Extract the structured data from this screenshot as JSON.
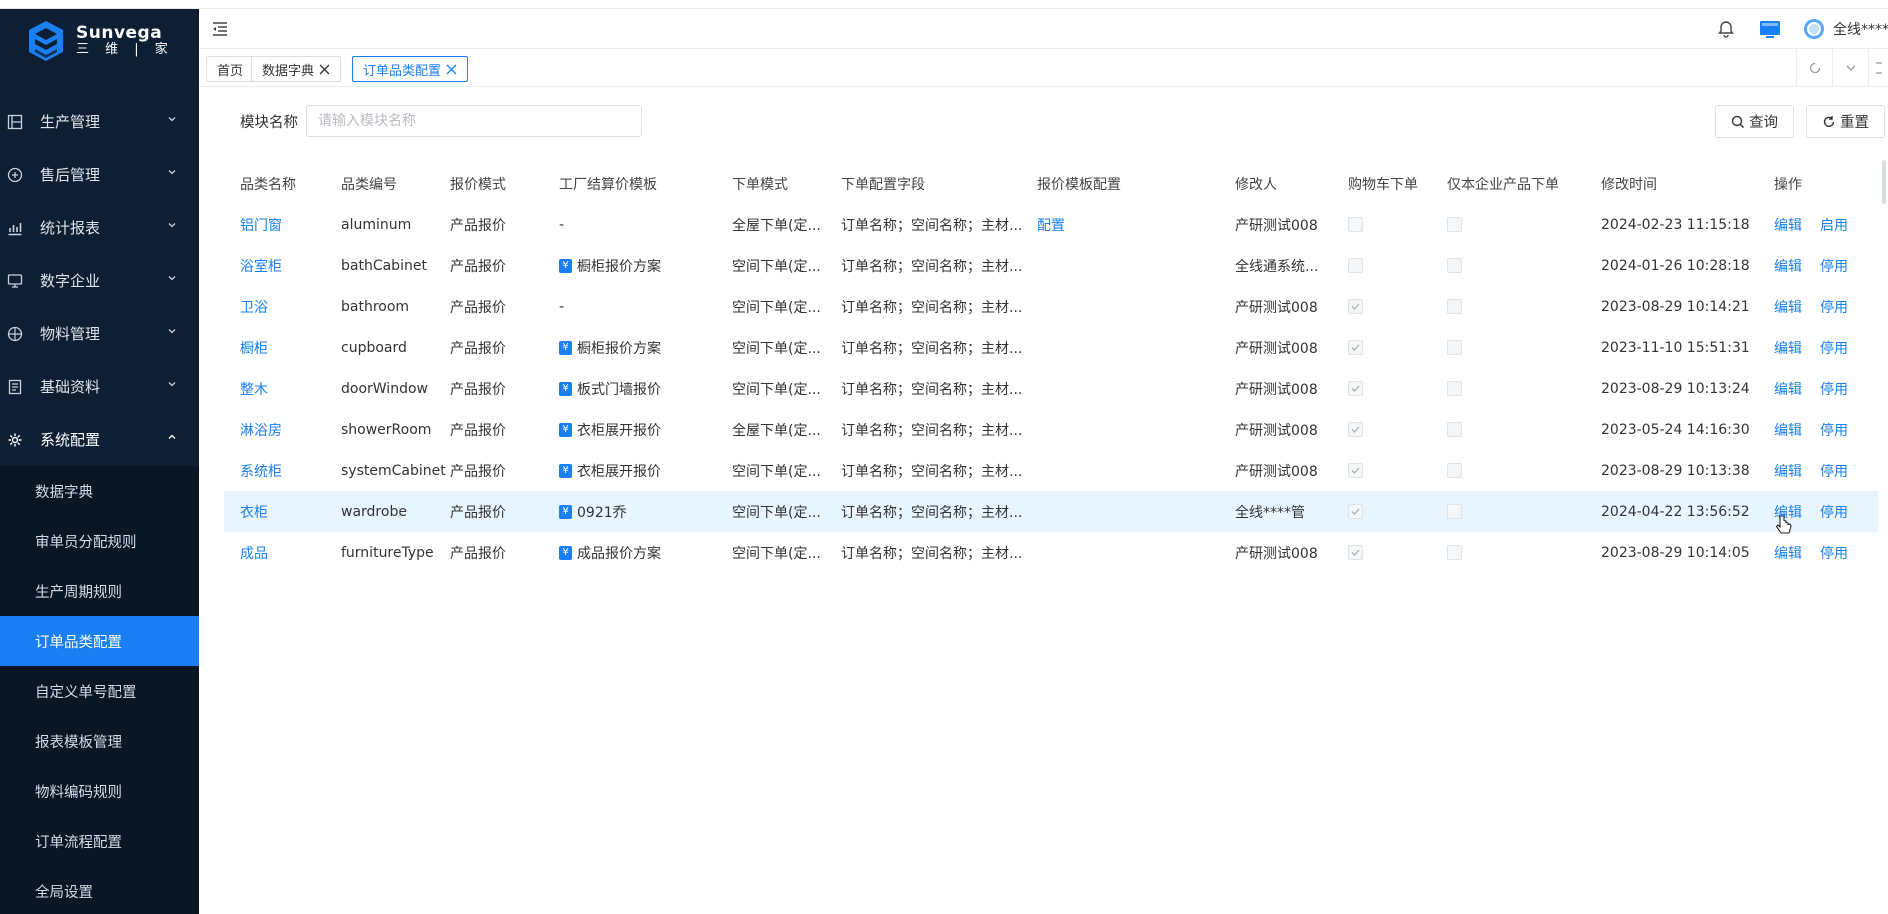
{
  "brand": {
    "name": "Sunvega",
    "sub": "三 维 | 家"
  },
  "sidebar": {
    "items": [
      {
        "label": "生产管理",
        "icon": "production-icon"
      },
      {
        "label": "售后管理",
        "icon": "aftersale-icon"
      },
      {
        "label": "统计报表",
        "icon": "chart-icon"
      },
      {
        "label": "数字企业",
        "icon": "monitor-icon"
      },
      {
        "label": "物料管理",
        "icon": "box-icon"
      },
      {
        "label": "基础资料",
        "icon": "document-icon"
      },
      {
        "label": "系统配置",
        "icon": "gear-icon",
        "expanded": true
      }
    ],
    "subitems": [
      {
        "label": "数据字典"
      },
      {
        "label": "审单员分配规则"
      },
      {
        "label": "生产周期规则"
      },
      {
        "label": "订单品类配置",
        "active": true
      },
      {
        "label": "自定义单号配置"
      },
      {
        "label": "报表模板管理"
      },
      {
        "label": "物料编码规则"
      },
      {
        "label": "订单流程配置"
      },
      {
        "label": "全局设置"
      }
    ]
  },
  "header": {
    "user": "全线****"
  },
  "tabs": [
    {
      "label": "首页"
    },
    {
      "label": "数据字典"
    },
    {
      "label": "订单品类配置",
      "active": true
    }
  ],
  "search": {
    "label": "模块名称",
    "placeholder": "请输入模块名称",
    "query_label": "查询",
    "reset_label": "重置"
  },
  "table": {
    "columns": [
      "品类名称",
      "品类编号",
      "报价模式",
      "工厂结算价模板",
      "下单模式",
      "下单配置字段",
      "报价模板配置",
      "修改人",
      "购物车下单",
      "仅本企业产品下单",
      "修改时间",
      "操作"
    ],
    "rows": [
      {
        "name": "铝门窗",
        "code": "aluminum",
        "quote_mode": "产品报价",
        "template": "-",
        "template_icon": false,
        "order_mode": "全屋下单(定...",
        "fields": "订单名称；空间名称；主材...",
        "quote_config": "配置",
        "modifier": "产研测试008",
        "cart": false,
        "only_own": false,
        "time": "2024-02-23 11:15:18",
        "edit": "编辑",
        "toggle": "启用"
      },
      {
        "name": "浴室柜",
        "code": "bathCabinet",
        "quote_mode": "产品报价",
        "template": "橱柜报价方案",
        "template_icon": true,
        "order_mode": "空间下单(定...",
        "fields": "订单名称；空间名称；主材...",
        "quote_config": "",
        "modifier": "全线通系统...",
        "cart": false,
        "only_own": false,
        "time": "2024-01-26 10:28:18",
        "edit": "编辑",
        "toggle": "停用"
      },
      {
        "name": "卫浴",
        "code": "bathroom",
        "quote_mode": "产品报价",
        "template": "-",
        "template_icon": false,
        "order_mode": "空间下单(定...",
        "fields": "订单名称；空间名称；主材...",
        "quote_config": "",
        "modifier": "产研测试008",
        "cart": true,
        "only_own": false,
        "time": "2023-08-29 10:14:21",
        "edit": "编辑",
        "toggle": "停用"
      },
      {
        "name": "橱柜",
        "code": "cupboard",
        "quote_mode": "产品报价",
        "template": "橱柜报价方案",
        "template_icon": true,
        "order_mode": "空间下单(定...",
        "fields": "订单名称；空间名称；主材...",
        "quote_config": "",
        "modifier": "产研测试008",
        "cart": true,
        "only_own": false,
        "time": "2023-11-10 15:51:31",
        "edit": "编辑",
        "toggle": "停用"
      },
      {
        "name": "整木",
        "code": "doorWindow",
        "quote_mode": "产品报价",
        "template": "板式门墙报价",
        "template_icon": true,
        "order_mode": "空间下单(定...",
        "fields": "订单名称；空间名称；主材...",
        "quote_config": "",
        "modifier": "产研测试008",
        "cart": true,
        "only_own": false,
        "time": "2023-08-29 10:13:24",
        "edit": "编辑",
        "toggle": "停用"
      },
      {
        "name": "淋浴房",
        "code": "showerRoom",
        "quote_mode": "产品报价",
        "template": "衣柜展开报价",
        "template_icon": true,
        "order_mode": "全屋下单(定...",
        "fields": "订单名称；空间名称；主材...",
        "quote_config": "",
        "modifier": "产研测试008",
        "cart": true,
        "only_own": false,
        "time": "2023-05-24 14:16:30",
        "edit": "编辑",
        "toggle": "停用"
      },
      {
        "name": "系统柜",
        "code": "systemCabinet",
        "quote_mode": "产品报价",
        "template": "衣柜展开报价",
        "template_icon": true,
        "order_mode": "空间下单(定...",
        "fields": "订单名称；空间名称；主材...",
        "quote_config": "",
        "modifier": "产研测试008",
        "cart": true,
        "only_own": false,
        "time": "2023-08-29 10:13:38",
        "edit": "编辑",
        "toggle": "停用"
      },
      {
        "name": "衣柜",
        "code": "wardrobe",
        "quote_mode": "产品报价",
        "template": "0921乔",
        "template_icon": true,
        "order_mode": "空间下单(定...",
        "fields": "订单名称；空间名称；主材...",
        "quote_config": "",
        "modifier": "全线****管",
        "cart": true,
        "only_own": false,
        "time": "2024-04-22 13:56:52",
        "edit": "编辑",
        "toggle": "停用",
        "hover": true
      },
      {
        "name": "成品",
        "code": "furnitureType",
        "quote_mode": "产品报价",
        "template": "成品报价方案",
        "template_icon": true,
        "order_mode": "空间下单(定...",
        "fields": "订单名称；空间名称；主材...",
        "quote_config": "",
        "modifier": "产研测试008",
        "cart": true,
        "only_own": false,
        "time": "2023-08-29 10:14:05",
        "edit": "编辑",
        "toggle": "停用"
      }
    ]
  },
  "colors": {
    "accent": "#1a7ff2",
    "sidebar_bg": "#0f1f33",
    "row_hover": "#e8f4fe"
  }
}
